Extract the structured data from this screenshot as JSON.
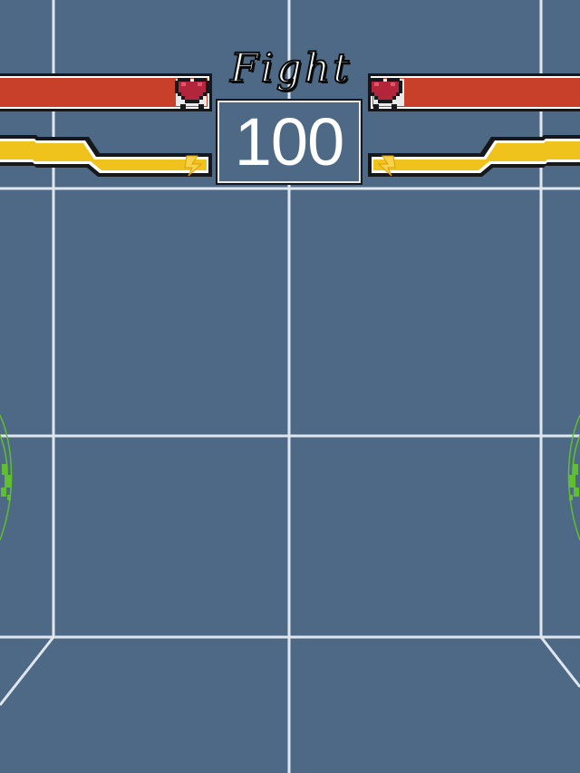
{
  "hud": {
    "title": "Fight",
    "timer": "100",
    "colors": {
      "background": "#4d6985",
      "grid_line": "#dfe6ee",
      "health": "#c8402a",
      "energy": "#f0c21c",
      "outline": "#16181c",
      "heart": "#b2253a",
      "fighter": "#5fbf2e"
    },
    "player_left": {
      "health_icon": "heart-icon",
      "energy_icon": "lightning-icon",
      "health": 1.0,
      "energy": 1.0
    },
    "player_right": {
      "health_icon": "heart-icon",
      "energy_icon": "lightning-icon",
      "health": 1.0,
      "energy": 1.0
    }
  }
}
